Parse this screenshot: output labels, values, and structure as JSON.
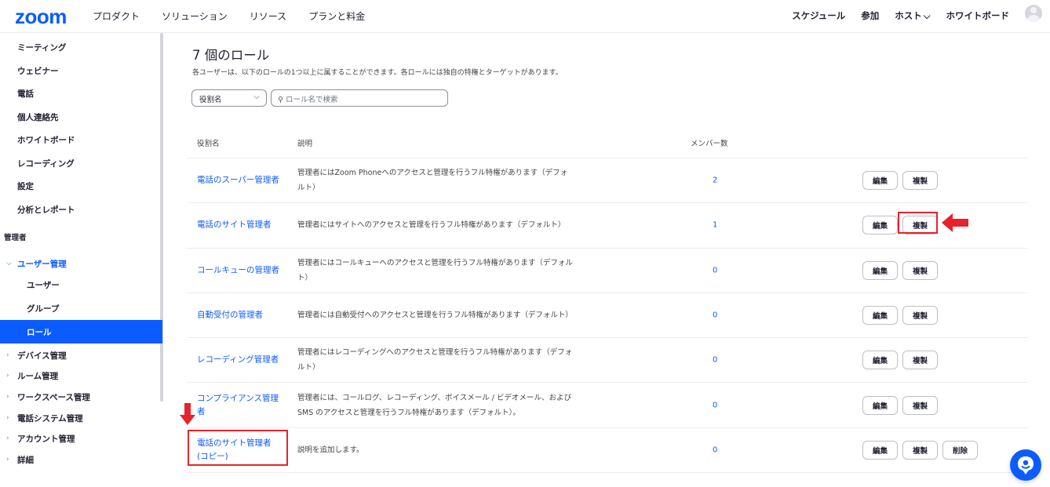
{
  "brand": {
    "logo": "zoom",
    "accent": "#0b5cff",
    "highlight": "#e8222a"
  },
  "topnav": {
    "left": [
      "プロダクト",
      "ソリューション",
      "リソース",
      "プランと料金"
    ],
    "right": {
      "schedule": "スケジュール",
      "join": "参加",
      "host": "ホスト",
      "whiteboard": "ホワイトボード"
    }
  },
  "sidebar": {
    "meeting": "ミーティング",
    "webinar": "ウェビナー",
    "phone": "電話",
    "contacts": "個人連絡先",
    "whiteboard": "ホワイトボード",
    "recording": "レコーディング",
    "settings": "設定",
    "analytics": "分析とレポート",
    "admin_header": "管理者",
    "user_mgmt": "ユーザー管理",
    "users": "ユーザー",
    "groups": "グループ",
    "roles": "ロール",
    "device_mgmt": "デバイス管理",
    "room_mgmt": "ルーム管理",
    "workspace_mgmt": "ワークスペース管理",
    "phone_system": "電話システム管理",
    "account_mgmt": "アカウント管理",
    "advanced": "詳細"
  },
  "main": {
    "title": "7 個のロール",
    "subtitle": "各ユーザーは、以下のロールの1つ以上に属することができます。各ロールには独自の特権とターゲットがあります。",
    "filter_value": "役割名",
    "search_placeholder": "ロール名で検索",
    "columns": {
      "name": "役割名",
      "desc": "説明",
      "members": "メンバー数"
    },
    "buttons": {
      "edit": "編集",
      "copy": "複製",
      "delete": "削除"
    },
    "rows": [
      {
        "name": "電話のスーパー管理者",
        "desc": "管理者にはZoom Phoneへのアクセスと管理を行うフル特権があります（デフォルト）",
        "count": "2"
      },
      {
        "name": "電話のサイト管理者",
        "desc": "管理者にはサイトへのアクセスと管理を行うフル特権があります（デフォルト）",
        "count": "1"
      },
      {
        "name": "コールキューの管理者",
        "desc": "管理者にはコールキューへのアクセスと管理を行うフル特権があります（デフォルト）",
        "count": "0"
      },
      {
        "name": "自動受付の管理者",
        "desc": "管理者には自動受付へのアクセスと管理を行うフル特権があります（デフォルト）",
        "count": "0"
      },
      {
        "name": "レコーディング管理者",
        "desc": "管理者にはレコーディングへのアクセスと管理を行うフル特権があります（デフォルト）",
        "count": "0"
      },
      {
        "name": "コンプライアンス管理者",
        "desc": "管理者には、コールログ、レコーディング、ボイスメール / ビデオメール、および SMS のアクセスと管理を行うフル特権があります（デフォルト）。",
        "count": "0"
      },
      {
        "name": "電話のサイト管理者 (コピー)",
        "desc": "説明を追加します。",
        "count": "0"
      }
    ]
  }
}
